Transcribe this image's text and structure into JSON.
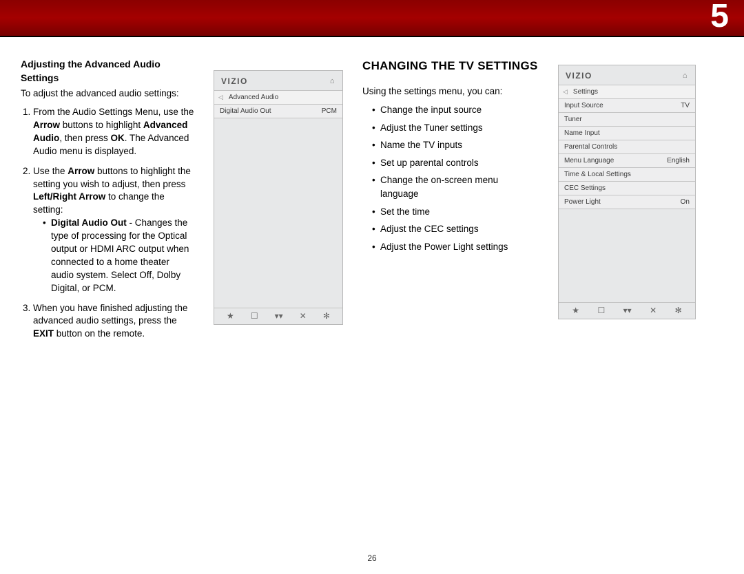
{
  "chapter_number": "5",
  "page_number": "26",
  "left": {
    "heading": "Adjusting the Advanced Audio Settings",
    "intro": "To adjust the advanced audio settings:",
    "step1_a": "From the Audio Settings Menu, use the ",
    "step1_b": "Arrow",
    "step1_c": " buttons to highlight ",
    "step1_d": "Advanced Audio",
    "step1_e": ", then press ",
    "step1_f": "OK",
    "step1_g": ". The Advanced Audio menu is displayed.",
    "step2_a": "Use the ",
    "step2_b": "Arrow",
    "step2_c": " buttons to highlight the setting you wish to adjust, then press ",
    "step2_d": "Left/Right Arrow",
    "step2_e": " to change the setting:",
    "dao_label": "Digital Audio Out",
    "dao_desc": " - Changes the type of processing for the Optical output or HDMI ARC output when connected to a home theater audio system. Select Off, Dolby Digital, or PCM.",
    "step3_a": "When you have finished adjusting the advanced audio settings, press the ",
    "step3_b": "EXIT",
    "step3_c": " button on the remote."
  },
  "leftpanel": {
    "brand": "VIZIO",
    "title": "Advanced Audio",
    "row1_label": "Digital Audio Out",
    "row1_value": "PCM"
  },
  "right": {
    "heading": "CHANGING THE TV SETTINGS",
    "intro": "Using the settings menu, you can:",
    "items": {
      "0": "Change the input source",
      "1": "Adjust the Tuner settings",
      "2": "Name the TV inputs",
      "3": "Set up parental controls",
      "4": "Change the on-screen menu language",
      "5": "Set the time",
      "6": "Adjust the CEC settings",
      "7": "Adjust the Power Light settings"
    }
  },
  "rightpanel": {
    "brand": "VIZIO",
    "title": "Settings",
    "rows": {
      "0": {
        "label": "Input Source",
        "value": "TV"
      },
      "1": {
        "label": "Tuner",
        "value": ""
      },
      "2": {
        "label": "Name Input",
        "value": ""
      },
      "3": {
        "label": "Parental Controls",
        "value": ""
      },
      "4": {
        "label": "Menu Language",
        "value": "English"
      },
      "5": {
        "label": "Time & Local Settings",
        "value": ""
      },
      "6": {
        "label": "CEC Settings",
        "value": ""
      },
      "7": {
        "label": "Power Light",
        "value": "On"
      }
    }
  },
  "icons": {
    "home": "⌂",
    "back": "◁",
    "star": "★",
    "cc": "☐",
    "v": "▾▾",
    "x": "✕",
    "gear": "✻"
  }
}
